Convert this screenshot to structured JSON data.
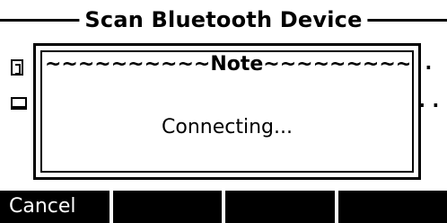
{
  "screen": {
    "title": "Scan Bluetooth Device"
  },
  "background_list": {
    "rows": [
      {
        "icon": "bluetooth-icon",
        "trailing": "."
      },
      {
        "icon": "device-icon",
        "trailing": ".."
      }
    ]
  },
  "dialog": {
    "header": "~~~~~~~~~~Note~~~~~~~~~~",
    "message": "Connecting..."
  },
  "softkeys": [
    {
      "label": "Cancel"
    },
    {
      "label": ""
    },
    {
      "label": ""
    },
    {
      "label": ""
    }
  ]
}
